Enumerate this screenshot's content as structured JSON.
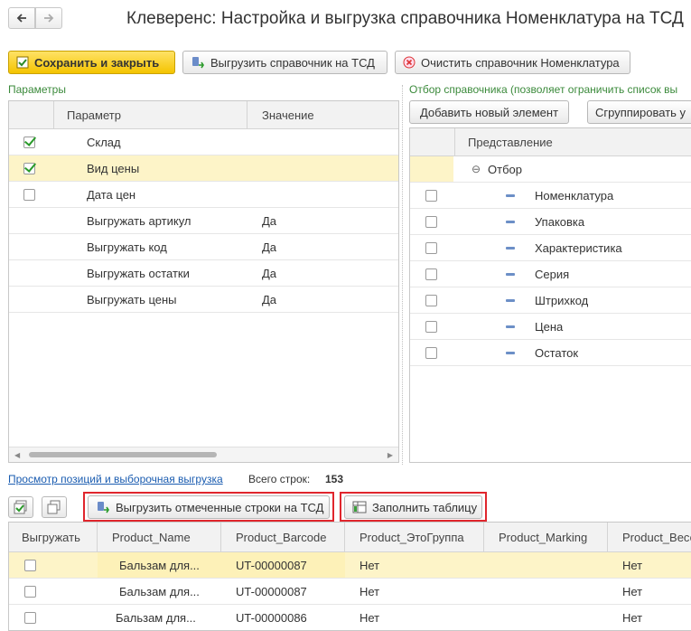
{
  "window": {
    "title": "Клеверенс: Настройка и выгрузка справочника Номенклатура на ТСД"
  },
  "toolbar": {
    "save_close": "Сохранить и закрыть",
    "export_catalog": "Выгрузить справочник на ТСД",
    "clear_catalog": "Очистить справочник Номенклатура"
  },
  "params": {
    "section": "Параметры",
    "col_param": "Параметр",
    "col_value": "Значение",
    "rows": [
      {
        "name": "Склад",
        "value": "",
        "check": true
      },
      {
        "name": "Вид цены",
        "value": "",
        "check": true
      },
      {
        "name": "Дата цен",
        "value": "",
        "check": false
      },
      {
        "name": "Выгружать артикул",
        "value": "Да"
      },
      {
        "name": "Выгружать код",
        "value": "Да"
      },
      {
        "name": "Выгружать остатки",
        "value": "Да"
      },
      {
        "name": "Выгружать цены",
        "value": "Да"
      }
    ]
  },
  "filter": {
    "section": "Отбор справочника (позволяет ограничить список вы",
    "add_element": "Добавить новый элемент",
    "group": "Сгруппировать у",
    "col_repr": "Представление",
    "group_label": "Отбор",
    "items": [
      "Номенклатура",
      "Упаковка",
      "Характеристика",
      "Серия",
      "Штрихкод",
      "Цена",
      "Остаток"
    ]
  },
  "preview": {
    "link": "Просмотр позиций и выборочная выгрузка",
    "total_label": "Всего строк:",
    "total_value": "153",
    "export_marked": "Выгрузить отмеченные строки на ТСД",
    "fill_table": "Заполнить таблицу"
  },
  "table": {
    "columns": [
      "Выгружать",
      "Product_Name",
      "Product_Barcode",
      "Product_ЭтоГруппа",
      "Product_Marking",
      "Product_Весо"
    ],
    "rows": [
      {
        "name": "Бальзам  для...",
        "barcode": "UT-00000087",
        "group": "Нет",
        "marking": "",
        "weight": "Нет"
      },
      {
        "name": "Бальзам  для...",
        "barcode": "UT-00000087",
        "group": "Нет",
        "marking": "",
        "weight": "Нет"
      },
      {
        "name": "Бальзам  для...",
        "barcode": "UT-00000086",
        "group": "Нет",
        "marking": "",
        "weight": "Нет"
      }
    ]
  }
}
